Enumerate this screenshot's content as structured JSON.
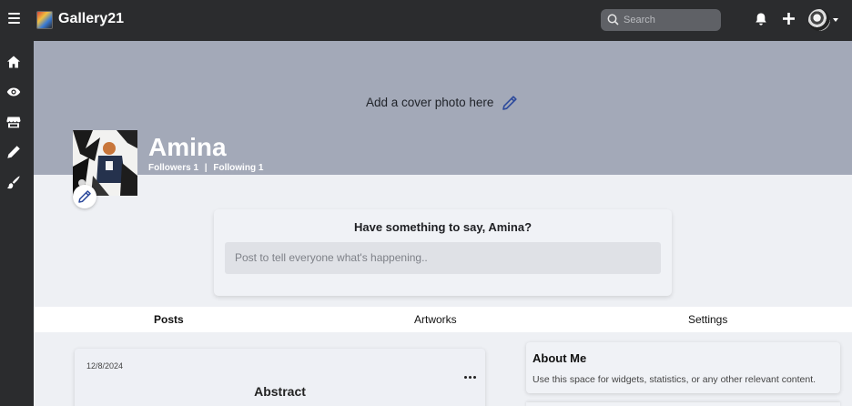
{
  "header": {
    "app_name": "Gallery21",
    "search_placeholder": "Search",
    "icons": [
      "menu-icon",
      "app-logo",
      "search-icon",
      "bell-icon",
      "plus-icon",
      "avatar",
      "caret-down-icon"
    ]
  },
  "sidebar": {
    "items": [
      {
        "icon": "home-icon"
      },
      {
        "icon": "eye-icon"
      },
      {
        "icon": "store-icon"
      },
      {
        "icon": "pencil-icon"
      },
      {
        "icon": "brush-icon"
      }
    ]
  },
  "cover": {
    "prompt": "Add a cover photo here"
  },
  "profile": {
    "name": "Amina",
    "followers": "Followers 1",
    "separator": "|",
    "following": "Following 1"
  },
  "composer": {
    "title": "Have something to say, Amina?",
    "placeholder": "Post to tell everyone what's happening.."
  },
  "tabs": [
    {
      "label": "Posts",
      "active": true
    },
    {
      "label": "Artworks",
      "active": false
    },
    {
      "label": "Settings",
      "active": false
    }
  ],
  "post": {
    "date": "12/8/2024",
    "title": "Abstract"
  },
  "about": {
    "title": "About Me",
    "text": "Use this space for widgets, statistics, or any other relevant content."
  },
  "colors": {
    "topbar": "#2b2c2e",
    "cover": "#a3a9b8",
    "page_bg": "#eef0f4",
    "accent_pencil": "#2d4a9c"
  }
}
